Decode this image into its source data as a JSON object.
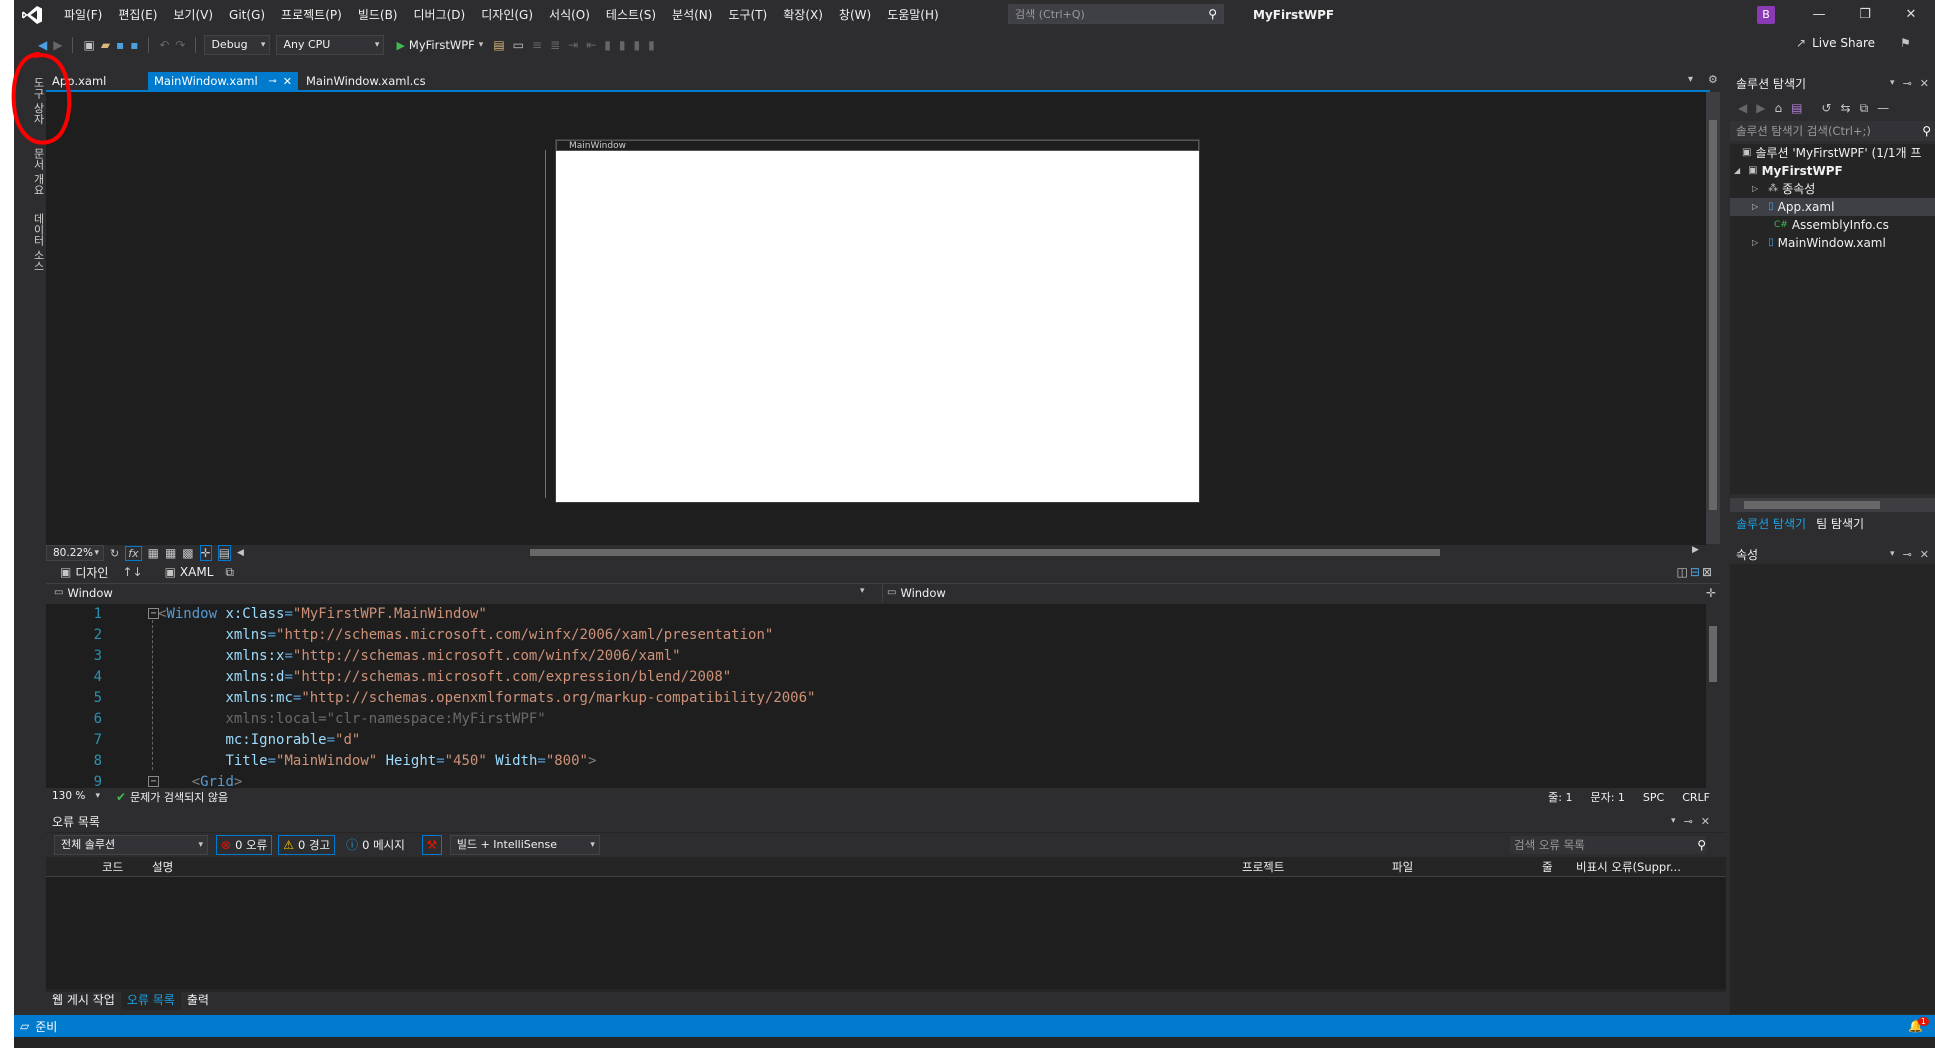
{
  "menu": [
    "파일(F)",
    "편집(E)",
    "보기(V)",
    "Git(G)",
    "프로젝트(P)",
    "빌드(B)",
    "디버그(D)",
    "디자인(G)",
    "서식(O)",
    "테스트(S)",
    "분석(N)",
    "도구(T)",
    "확장(X)",
    "창(W)",
    "도움말(H)"
  ],
  "search": {
    "placeholder": "검색 (Ctrl+Q)"
  },
  "window_title": "MyFirstWPF",
  "avatar_initial": "B",
  "toolbar": {
    "config": "Debug",
    "platform": "Any CPU",
    "run_target": "MyFirstWPF",
    "live_share": "Live Share"
  },
  "left_strip": [
    "도구 상자",
    "문서 개요",
    "데이터 소스"
  ],
  "doc_tabs": [
    {
      "label": "App.xaml",
      "active": false
    },
    {
      "label": "MainWindow.xaml",
      "active": true
    },
    {
      "label": "MainWindow.xaml.cs",
      "active": false
    }
  ],
  "designer": {
    "window_caption": "MainWindow",
    "zoom": "80.22%",
    "fx": "fx"
  },
  "split": {
    "design_tab": "디자인",
    "swap": "↑↓",
    "xaml_tab": "XAML"
  },
  "nav": {
    "left": "Window",
    "right": "Window"
  },
  "code_lines": [
    "1",
    "2",
    "3",
    "4",
    "5",
    "6",
    "7",
    "8",
    "9"
  ],
  "code": {
    "l1_tag": "Window",
    "l1_attr": "x:Class",
    "l1_val": "\"MyFirstWPF.MainWindow\"",
    "l2_attr": "xmlns",
    "l2_val": "\"http://schemas.microsoft.com/winfx/2006/xaml/presentation\"",
    "l3_attr": "xmlns:x",
    "l3_val": "\"http://schemas.microsoft.com/winfx/2006/xaml\"",
    "l4_attr": "xmlns:d",
    "l4_val": "\"http://schemas.microsoft.com/expression/blend/2008\"",
    "l5_attr": "xmlns:mc",
    "l5_val": "\"http://schemas.openxmlformats.org/markup-compatibility/2006\"",
    "l6_attr": "xmlns:local",
    "l6_val": "\"clr-namespace:MyFirstWPF\"",
    "l7_attr": "mc:Ignorable",
    "l7_val": "\"d\"",
    "l8_a1": "Title",
    "l8_v1": "\"MainWindow\"",
    "l8_a2": "Height",
    "l8_v2": "\"450\"",
    "l8_a3": "Width",
    "l8_v3": "\"800\"",
    "l9_tag": "Grid"
  },
  "editor_status": {
    "zoom": "130 %",
    "issues": "문제가 검색되지 않음",
    "line": "줄: 1",
    "col": "문자: 1",
    "spc": "SPC",
    "eol": "CRLF"
  },
  "error_list": {
    "title": "오류 목록",
    "scope": "전체 솔루션",
    "errors": "0 오류",
    "warnings": "0 경고",
    "messages": "0 메시지",
    "filter": "빌드 + IntelliSense",
    "search_placeholder": "검색 오류 목록",
    "columns": [
      "코드",
      "설명",
      "프로젝트",
      "파일",
      "줄",
      "비표시 오류(Suppr..."
    ]
  },
  "bottom_tabs": [
    {
      "label": "웹 게시 작업",
      "active": false
    },
    {
      "label": "오류 목록",
      "active": true
    },
    {
      "label": "출력",
      "active": false
    }
  ],
  "solution_explorer": {
    "title": "솔루션 탐색기",
    "search_placeholder": "솔루션 탐색기 검색(Ctrl+;)",
    "tree": [
      {
        "label": "솔루션 'MyFirstWPF' (1/1개 프",
        "bold": false,
        "level": 0
      },
      {
        "label": "MyFirstWPF",
        "bold": true,
        "level": 1
      },
      {
        "label": "종속성",
        "bold": false,
        "level": 2
      },
      {
        "label": "App.xaml",
        "bold": false,
        "level": 2
      },
      {
        "label": "AssemblyInfo.cs",
        "bold": false,
        "level": 2
      },
      {
        "label": "MainWindow.xaml",
        "bold": false,
        "level": 2
      }
    ],
    "tabs": [
      "솔루션 탐색기",
      "팀 탐색기"
    ]
  },
  "properties": {
    "title": "속성"
  },
  "statusbar": {
    "text": "준비",
    "notification_count": "1"
  },
  "colors": {
    "accent": "#007acc",
    "bg": "#2d2d30",
    "editor": "#1e1e1e",
    "annotation": "#ff0000"
  }
}
